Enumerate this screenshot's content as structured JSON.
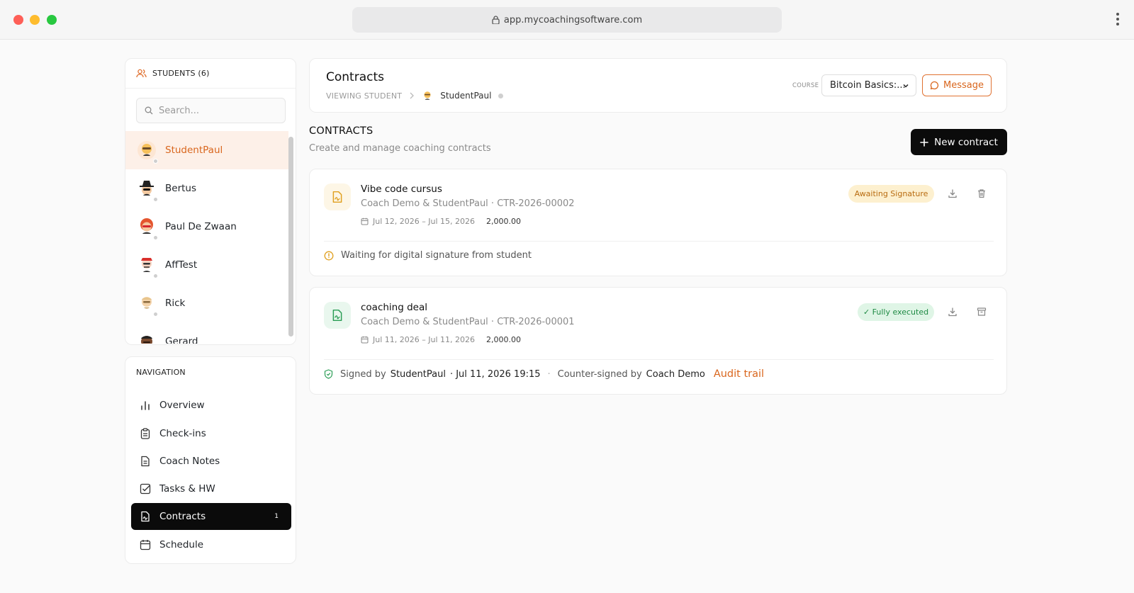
{
  "browser": {
    "url": "app.mycoachingsoftware.com"
  },
  "students": {
    "heading": "STUDENTS (6)",
    "search_placeholder": "Search...",
    "items": [
      {
        "name": "StudentPaul",
        "active": true
      },
      {
        "name": "Bertus"
      },
      {
        "name": "Paul De Zwaan"
      },
      {
        "name": "AffTest"
      },
      {
        "name": "Rick"
      },
      {
        "name": "Gerard"
      }
    ]
  },
  "navigation": {
    "heading": "NAVIGATION",
    "items": [
      {
        "label": "Overview",
        "icon": "bar-chart-icon"
      },
      {
        "label": "Check-ins",
        "icon": "clipboard-icon"
      },
      {
        "label": "Coach Notes",
        "icon": "document-icon"
      },
      {
        "label": "Tasks & HW",
        "icon": "checkbox-icon"
      },
      {
        "label": "Contracts",
        "icon": "signature-icon",
        "badge": "1",
        "active": true
      },
      {
        "label": "Schedule",
        "icon": "calendar-icon"
      }
    ]
  },
  "header": {
    "title": "Contracts",
    "viewing_label": "VIEWING STUDENT",
    "student_name": "StudentPaul",
    "course_label": "COURSE",
    "course_value": "Bitcoin Basics:...",
    "message_button": "Message"
  },
  "contracts_section": {
    "title": "CONTRACTS",
    "subtitle": "Create and manage coaching contracts",
    "new_button": "New contract",
    "items": [
      {
        "name": "Vibe code cursus",
        "parties": "Coach Demo & StudentPaul · CTR-2026-00002",
        "dates": "Jul 12, 2026 – Jul 15, 2026",
        "amount": "2,000.00",
        "status": "Awaiting Signature",
        "footer": "Waiting for digital signature from student"
      },
      {
        "name": "coaching deal",
        "parties": "Coach Demo & StudentPaul · CTR-2026-00001",
        "dates": "Jul 11, 2026 – Jul 11, 2026",
        "amount": "2,000.00",
        "status": "✓ Fully executed",
        "signed_prefix": "Signed by",
        "signed_by": "StudentPaul",
        "signed_at": "· Jul 11, 2026 19:15",
        "sep": "·",
        "countersigned_prefix": "Counter-signed by",
        "countersigned_by": "Coach Demo",
        "audit_link": "Audit trail"
      }
    ]
  },
  "colors": {
    "accent": "#d9661d",
    "dark": "#0b0b0b",
    "awaiting_bg": "#fdf0cf",
    "executed_bg": "#dff5e6"
  }
}
